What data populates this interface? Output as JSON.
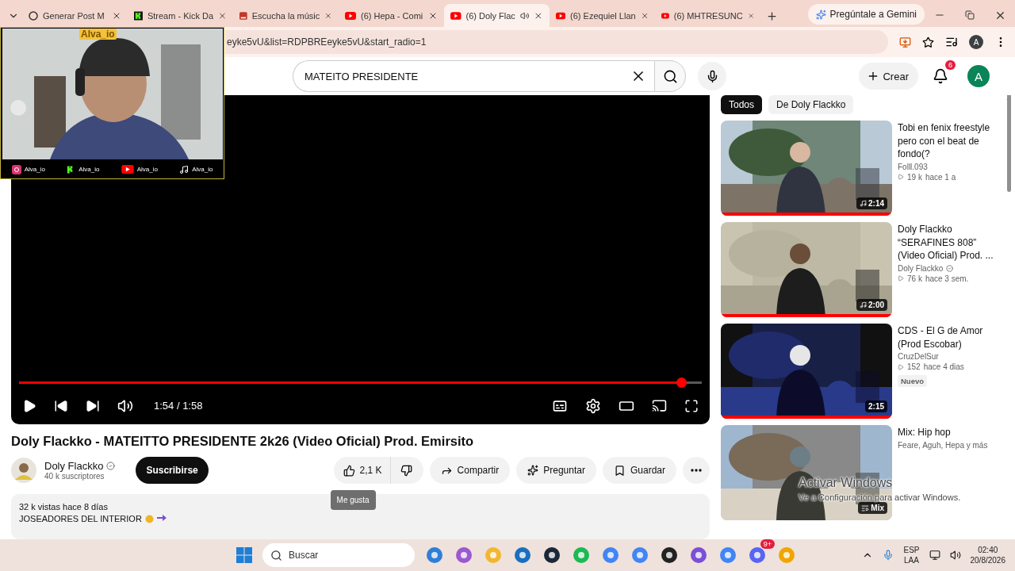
{
  "browser": {
    "tabs": [
      {
        "title": "Generar Post M",
        "kind": "chat",
        "selected": false,
        "playing": false
      },
      {
        "title": "Stream - Kick Da",
        "kind": "kick",
        "selected": false,
        "playing": false
      },
      {
        "title": "Escucha la músic",
        "kind": "music",
        "selected": false,
        "playing": false
      },
      {
        "title": "(6) Hepa - Comi",
        "kind": "youtube",
        "selected": false,
        "playing": false
      },
      {
        "title": "(6) Doly Flac",
        "kind": "youtube",
        "selected": true,
        "playing": true
      },
      {
        "title": "(6) Ezequiel Llan",
        "kind": "youtube",
        "selected": false,
        "playing": false
      },
      {
        "title": "(6) MHTRESUNC",
        "kind": "youtube",
        "selected": false,
        "playing": false
      }
    ],
    "gemini_button": "Pregúntale a Gemini",
    "url": "eyke5vU&list=RDPBREeyke5vU&start_radio=1",
    "profile": "A"
  },
  "overlay": {
    "name_tag": "Alva_io",
    "socials": [
      {
        "kind": "instagram",
        "handle": "Alva_io"
      },
      {
        "kind": "kick",
        "handle": "Alva_io"
      },
      {
        "kind": "youtube",
        "handle": "Alva_io"
      },
      {
        "kind": "tiktok",
        "handle": "Alva_io"
      }
    ]
  },
  "header": {
    "search": {
      "value": "MATEITO PRESIDENTE"
    },
    "create": "Crear",
    "notifications": "6",
    "avatar": "A"
  },
  "player": {
    "level": 0.971,
    "time": "1:54 / 1:58"
  },
  "video": {
    "title": "Doly Flackko - MATEITTO PRESIDENTE 2k26 (Video Oficial) Prod. Emirsito",
    "channel": "Doly Flackko",
    "verified": true,
    "subscribers": "40 k suscriptores",
    "subscribe": "Suscribirse",
    "likes": "2,1 K",
    "tooltip": "Me gusta",
    "actions": [
      {
        "kind": "share",
        "label": "Compartir"
      },
      {
        "kind": "ask",
        "label": "Preguntar"
      },
      {
        "kind": "save",
        "label": "Guardar"
      }
    ],
    "stats": "32 k vistas  hace 8 días",
    "description": "JOSEADORES DEL INTERIOR"
  },
  "chips": [
    {
      "label": "Todos",
      "selected": true
    },
    {
      "label": "De Doly Flackko",
      "selected": false
    }
  ],
  "recommendations": [
    {
      "kind": "video",
      "title": "Tobi en fenix freestyle pero con el beat de fondo(?",
      "channel": "Folll.093",
      "verified": false,
      "views": "19 k",
      "age": "hace 1 a",
      "duration": "2:14",
      "music": true,
      "level": 1
    },
    {
      "kind": "video",
      "title": "Doly Flackko “SERAFINES 808” (Video Oficial) Prod. ...",
      "channel": "Doly Flackko",
      "verified": true,
      "views": "76 k",
      "age": "hace 3 sem.",
      "duration": "2:00",
      "music": true,
      "level": 1
    },
    {
      "kind": "video",
      "title": "CDS - El G de Amor (Prod Escobar)",
      "channel": "CruzDelSur",
      "verified": false,
      "views": "152",
      "age": "hace 4 dias",
      "duration": "2:15",
      "music": false,
      "badge": "Nuevo",
      "level": 1
    },
    {
      "kind": "mix",
      "title": "Mix: Hip hop",
      "subtitle": "Feare, Aguh, Hepa y más",
      "label": "Mix"
    }
  ],
  "watermark": {
    "title": "Activar Windows",
    "text": "Ve a Configuración para activar Windows."
  },
  "taskbar": {
    "search": "Buscar",
    "discord_badge": "9+",
    "language": "ESP",
    "layout": "LAA",
    "time": "02:40",
    "date": "20/8/2026"
  }
}
